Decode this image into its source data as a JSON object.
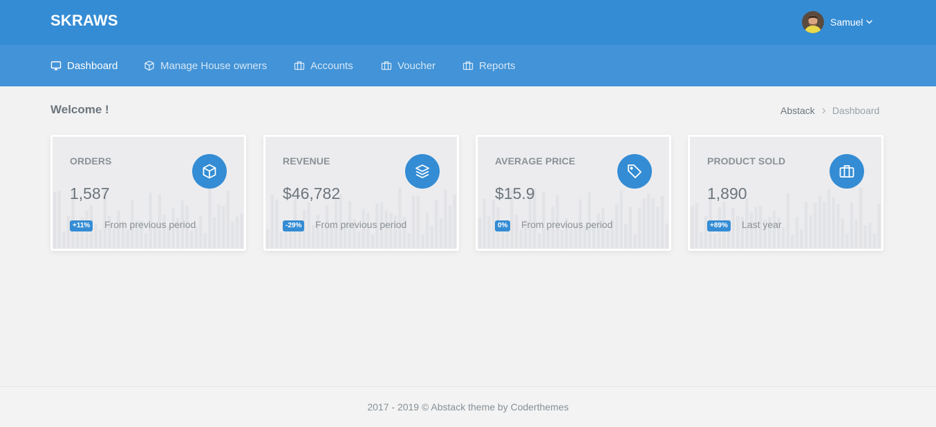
{
  "app": {
    "logo": "SKRAWS"
  },
  "user": {
    "name": "Samuel",
    "avatar_icon": "user-avatar"
  },
  "nav": {
    "items": [
      {
        "label": "Dashboard",
        "icon": "monitor-icon",
        "active": true
      },
      {
        "label": "Manage House owners",
        "icon": "box-icon",
        "active": false
      },
      {
        "label": "Accounts",
        "icon": "briefcase-icon",
        "active": false
      },
      {
        "label": "Voucher",
        "icon": "briefcase-icon",
        "active": false
      },
      {
        "label": "Reports",
        "icon": "briefcase-icon",
        "active": false
      }
    ]
  },
  "page": {
    "title": "Welcome !",
    "breadcrumb": [
      "Abstack",
      "Dashboard"
    ]
  },
  "stats": [
    {
      "label": "ORDERS",
      "value": "1,587",
      "badge": "+11%",
      "note": "From previous period",
      "icon": "box-icon"
    },
    {
      "label": "REVENUE",
      "value": "$46,782",
      "badge": "-29%",
      "note": "From previous period",
      "icon": "layers-icon"
    },
    {
      "label": "AVERAGE PRICE",
      "value": "$15.9",
      "badge": "0%",
      "note": "From previous period",
      "icon": "tag-icon"
    },
    {
      "label": "PRODUCT SOLD",
      "value": "1,890",
      "badge": "+89%",
      "note": "Last year",
      "icon": "briefcase-icon"
    }
  ],
  "footer": {
    "text": "2017 - 2019 © Abstack theme by Coderthemes"
  },
  "colors": {
    "primary": "#348cd4",
    "nav_bg": "#4293d7",
    "page_bg": "#f2f2f2",
    "card_bg": "#ececee",
    "text": "#6c757d"
  }
}
